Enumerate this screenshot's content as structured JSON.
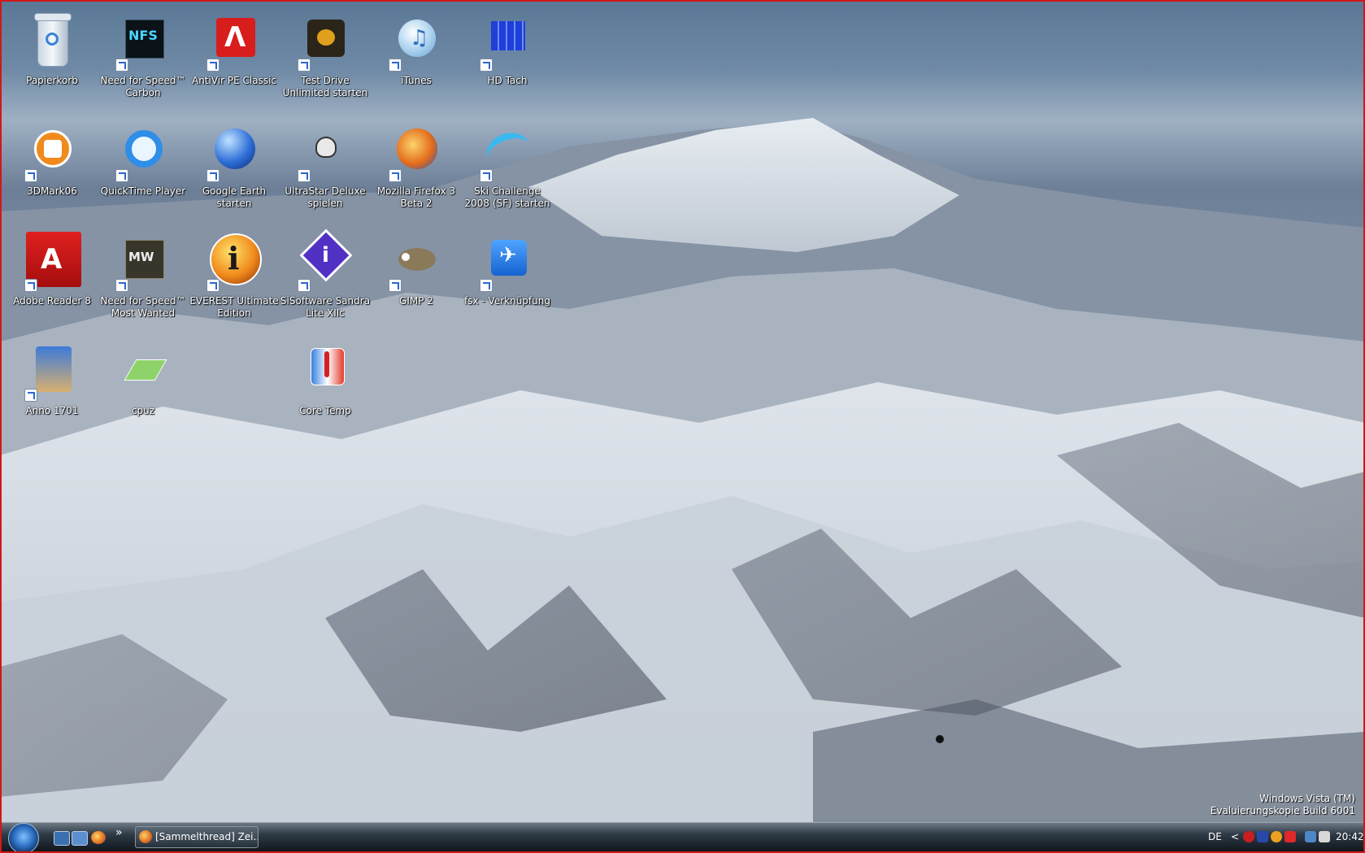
{
  "desktop": {
    "icons": [
      {
        "label": "Papierkorb",
        "icon": "recycle-bin-icon",
        "shortcut": false
      },
      {
        "label": "Need for Speed™ Carbon",
        "icon": "nfs-carbon-icon",
        "shortcut": true
      },
      {
        "label": "AntiVir PE Classic",
        "icon": "antivir-icon",
        "shortcut": true
      },
      {
        "label": "Test Drive Unlimited starten",
        "icon": "test-drive-icon",
        "shortcut": true
      },
      {
        "label": "iTunes",
        "icon": "itunes-icon",
        "shortcut": true
      },
      {
        "label": "HD Tach",
        "icon": "hd-tach-icon",
        "shortcut": true
      },
      {
        "label": "3DMark06",
        "icon": "3dmark-icon",
        "shortcut": true
      },
      {
        "label": "QuickTime Player",
        "icon": "quicktime-icon",
        "shortcut": true
      },
      {
        "label": "Google Earth starten",
        "icon": "google-earth-icon",
        "shortcut": true
      },
      {
        "label": "UltraStar Deluxe spielen",
        "icon": "ultrastar-icon",
        "shortcut": true
      },
      {
        "label": "Mozilla Firefox 3 Beta 2",
        "icon": "firefox-icon",
        "shortcut": true
      },
      {
        "label": "Ski Challenge 2008 (SF) starten",
        "icon": "ski-challenge-icon",
        "shortcut": true
      },
      {
        "label": "Adobe Reader 8",
        "icon": "adobe-reader-icon",
        "shortcut": true
      },
      {
        "label": "Need for Speed™ Most Wanted",
        "icon": "nfs-most-wanted-icon",
        "shortcut": true
      },
      {
        "label": "EVEREST Ultimate Edition",
        "icon": "everest-icon",
        "shortcut": true
      },
      {
        "label": "SiSoftware Sandra Lite XIIc",
        "icon": "sandra-icon",
        "shortcut": true
      },
      {
        "label": "GIMP 2",
        "icon": "gimp-icon",
        "shortcut": true
      },
      {
        "label": "fsx - Verknüpfung",
        "icon": "fsx-icon",
        "shortcut": true
      },
      {
        "label": "Anno 1701",
        "icon": "anno-icon",
        "shortcut": true
      },
      {
        "label": "cpuz",
        "icon": "cpuz-icon",
        "shortcut": false
      },
      {
        "label": "Core Temp",
        "icon": "core-temp-icon",
        "shortcut": false
      }
    ],
    "watermark": {
      "line1": "Windows Vista (TM)",
      "line2": "Evaluierungskopie Build 6001"
    }
  },
  "taskbar": {
    "start_icon": "windows-start-orb-icon",
    "quick_launch": [
      {
        "icon": "show-desktop-icon"
      },
      {
        "icon": "switch-windows-icon"
      },
      {
        "icon": "firefox-icon"
      }
    ],
    "overflow_label": "»",
    "task_button_label": "[Sammelthread] Zei...",
    "tray": {
      "language": "DE",
      "expand_label": "<",
      "clock": "20:42"
    }
  },
  "colors": {
    "border": "#d01818",
    "taskbar": "#1a232b",
    "label_text": "#ffffff"
  }
}
